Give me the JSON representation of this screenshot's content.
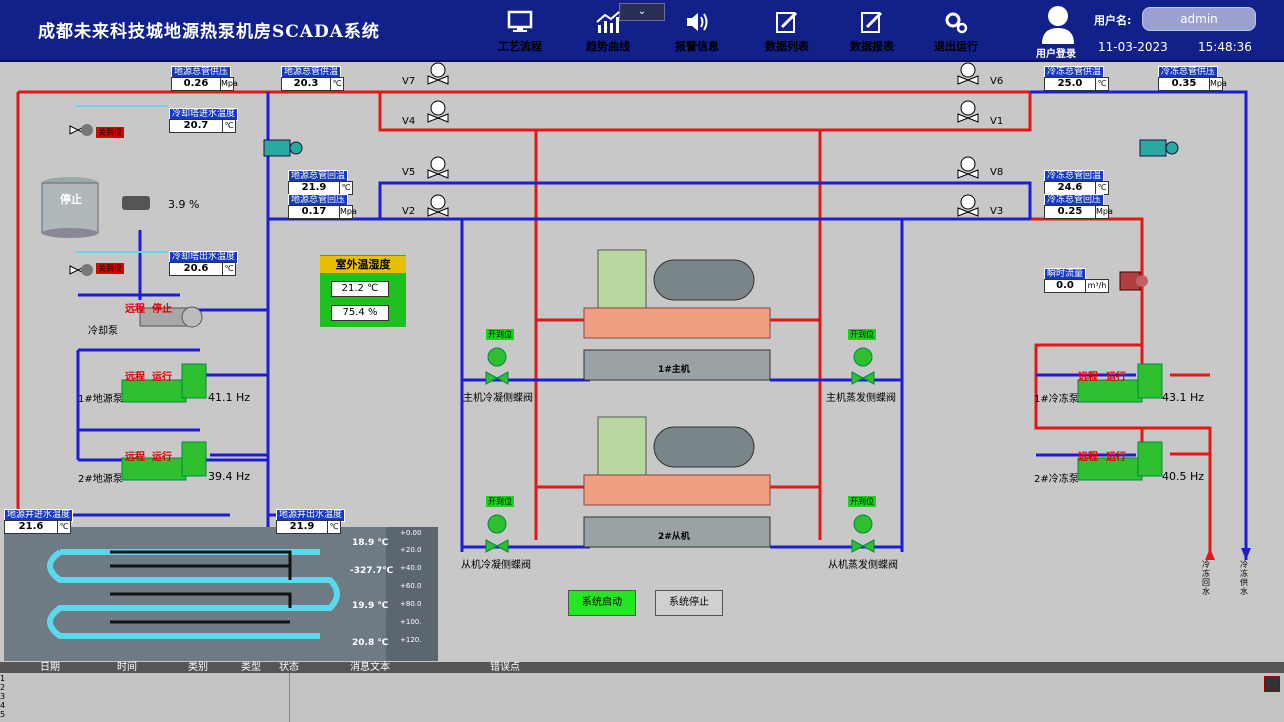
{
  "header": {
    "title": "成都未来科技城地源热泵机房SCADA系统",
    "nav": [
      {
        "label": "工艺流程",
        "icon": "monitor-icon"
      },
      {
        "label": "趋势曲线",
        "icon": "trend-chart-icon"
      },
      {
        "label": "报警信息",
        "icon": "speaker-icon"
      },
      {
        "label": "数据列表",
        "icon": "edit-list-icon"
      },
      {
        "label": "数据报表",
        "icon": "edit-report-icon"
      },
      {
        "label": "退出运行",
        "icon": "gear-icon"
      }
    ],
    "collapse_icon": "chevron-down-icon",
    "user_label": "用户名:",
    "user_name": "admin",
    "login_label": "用户登录",
    "date": "11-03-2023",
    "time": "15:48:36"
  },
  "tags": {
    "src_supply_press": {
      "label": "地源总管供压",
      "value": "0.26",
      "unit": "Mpa"
    },
    "src_supply_temp": {
      "label": "地源总管供温",
      "value": "20.3",
      "unit": "℃"
    },
    "cool_tower_in_temp": {
      "label": "冷却塔进水温度",
      "value": "20.7",
      "unit": "℃"
    },
    "cool_tower_out_temp": {
      "label": "冷却塔出水温度",
      "value": "20.6",
      "unit": "℃"
    },
    "src_return_temp": {
      "label": "地源总管回温",
      "value": "21.9",
      "unit": "℃"
    },
    "src_return_press": {
      "label": "地源总管回压",
      "value": "0.17",
      "unit": "Mpa"
    },
    "chill_supply_temp": {
      "label": "冷冻总管供温",
      "value": "25.0",
      "unit": "℃"
    },
    "chill_supply_press": {
      "label": "冷冻总管供压",
      "value": "0.35",
      "unit": "Mpa"
    },
    "chill_return_temp": {
      "label": "冷冻总管回温",
      "value": "24.6",
      "unit": "℃"
    },
    "chill_return_press": {
      "label": "冷冻总管回压",
      "value": "0.25",
      "unit": "Mpa"
    },
    "inst_flow": {
      "label": "瞬时流量",
      "value": "0.0",
      "unit": "m³/h"
    },
    "well_in_temp": {
      "label": "地源井进水温度",
      "value": "21.6",
      "unit": "℃"
    },
    "well_out_temp": {
      "label": "地源井出水温度",
      "value": "21.9",
      "unit": "℃"
    }
  },
  "valves": {
    "v7": "V7",
    "v4": "V4",
    "v5": "V5",
    "v2": "V2",
    "v6": "V6",
    "v1": "V1",
    "v8": "V8",
    "v3": "V3"
  },
  "cooling_tower": {
    "status": "停止",
    "fan_percent": "3.9 %",
    "valve_top_state": "关到位",
    "valve_bottom_state": "关到位"
  },
  "cooling_pump": {
    "mode": "远程",
    "status": "停止",
    "label": "冷却泵"
  },
  "source_pumps": [
    {
      "label": "1#地源泵",
      "mode": "远程",
      "status": "运行",
      "freq": "41.1 Hz"
    },
    {
      "label": "2#地源泵",
      "mode": "远程",
      "status": "运行",
      "freq": "39.4 Hz"
    }
  ],
  "chill_pumps": [
    {
      "label": "1#冷冻泵",
      "mode": "远程",
      "status": "运行",
      "freq": "43.1 Hz"
    },
    {
      "label": "2#冷冻泵",
      "mode": "远程",
      "status": "运行",
      "freq": "40.5 Hz"
    }
  ],
  "units": [
    {
      "label": "1#主机",
      "cond_valve_state": "开到位",
      "cond_valve_label": "主机冷凝侧蝶阀",
      "evap_valve_state": "开到位",
      "evap_valve_label": "主机蒸发侧蝶阀"
    },
    {
      "label": "2#从机",
      "cond_valve_state": "开到位",
      "cond_valve_label": "从机冷凝侧蝶阀",
      "evap_valve_state": "开到位",
      "evap_valve_label": "从机蒸发侧蝶阀"
    }
  ],
  "outdoor": {
    "title": "室外温湿度",
    "temp": "21.2 ℃",
    "humidity": "75.4 %"
  },
  "well": {
    "temps": [
      "18.9 ℃",
      "-327.7℃",
      "19.9 ℃",
      "20.8 ℃"
    ],
    "depth_ticks": [
      "+0.00",
      "+20.0",
      "+40.0",
      "+60.0",
      "+80.0",
      "+100.",
      "+120."
    ]
  },
  "pipe_labels": {
    "chill_return": "冷冻回水",
    "chill_supply": "冷冻供水"
  },
  "buttons": {
    "start": "系统启动",
    "stop": "系统停止"
  },
  "alarm_table": {
    "columns": [
      "日期",
      "时间",
      "类别",
      "类型",
      "状态",
      "消息文本",
      "错误点"
    ],
    "row_numbers": [
      "1",
      "2",
      "3",
      "4",
      "5"
    ]
  },
  "colors": {
    "header": "#12208a",
    "pipe_red": "#e01818",
    "pipe_blue": "#1d1dd6",
    "run_green": "#1ec01e",
    "stop_red": "#d00000"
  }
}
